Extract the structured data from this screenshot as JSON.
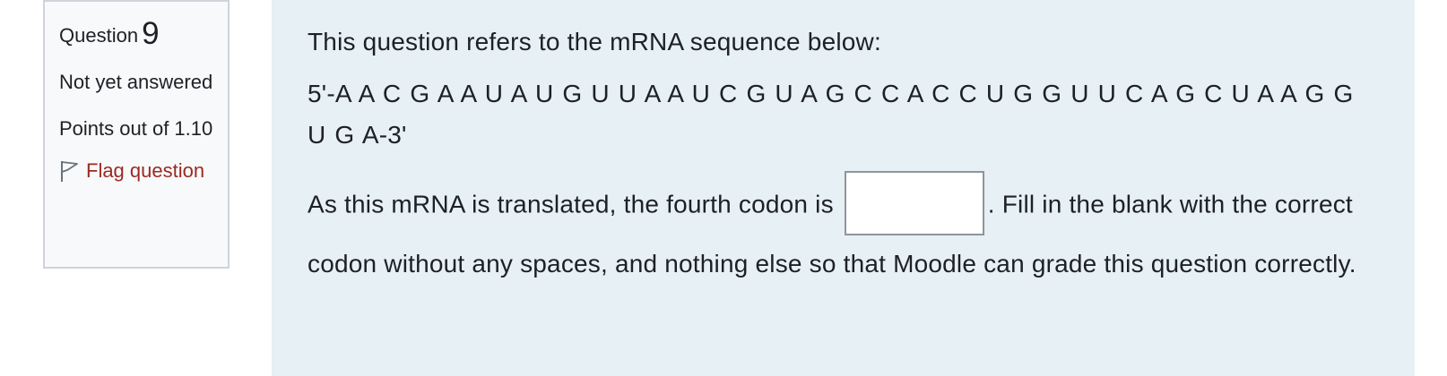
{
  "question_info": {
    "label": "Question",
    "number": "9",
    "state": "Not yet answered",
    "grade": "Points out of 1.10",
    "flag_label": "Flag question"
  },
  "question": {
    "intro": "This question refers to the mRNA sequence below:",
    "sequence": "5'-A A C G A A U A U G U U A A U C G U A G C C A C C U G G U U C A G C U A A G G U G A-3'",
    "text_before": "As this mRNA is translated, the fourth codon is",
    "answer_value": "",
    "text_after": ".  Fill in the blank with the correct codon without any spaces, and nothing else so that Moodle can grade this question correctly."
  },
  "colors": {
    "info_background": "#f8f9fa",
    "content_background": "#e7f0f4",
    "flag_link": "#9b2a22"
  },
  "icons": {
    "flag": "flag-outline-icon"
  }
}
